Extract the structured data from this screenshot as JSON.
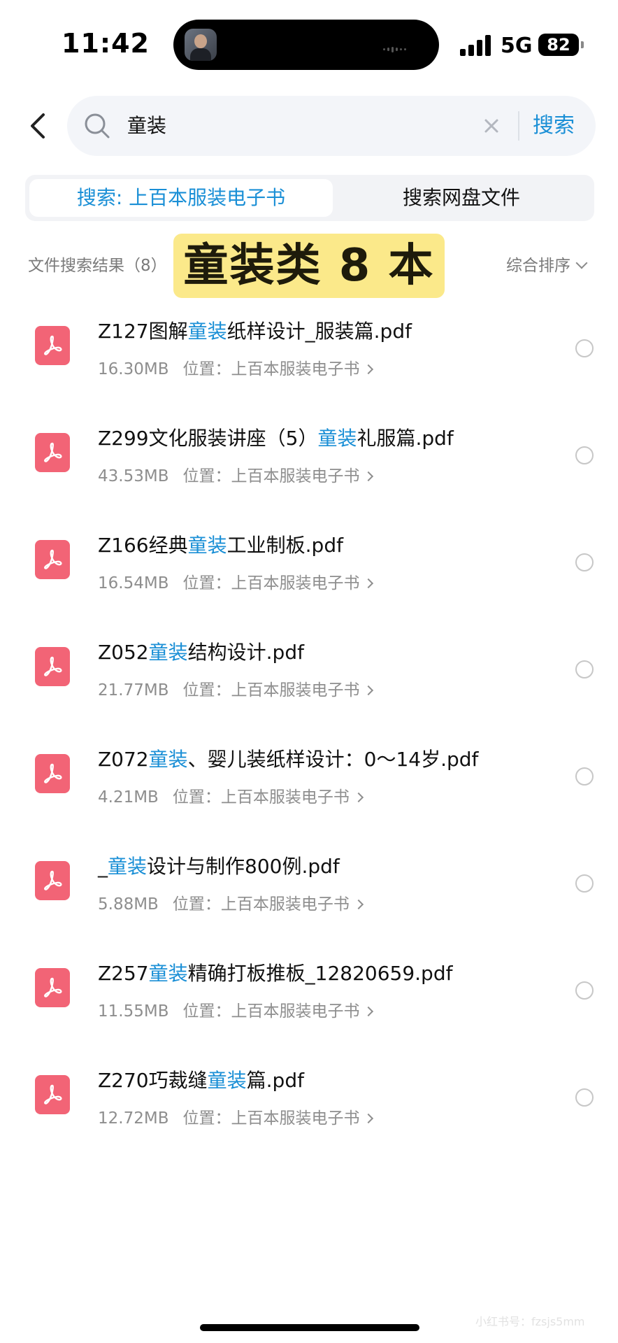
{
  "status_bar": {
    "time": "11:42",
    "network": "5G",
    "battery": "82"
  },
  "search": {
    "query": "童装",
    "button_label": "搜索"
  },
  "tabs": [
    {
      "label": "搜索: 上百本服装电子书",
      "active": true
    },
    {
      "label": "搜索网盘文件",
      "active": false
    }
  ],
  "results": {
    "title": "文件搜索结果（8）",
    "banner": "童装类 8 本",
    "sort_label": "综合排序"
  },
  "location_label": "位置：",
  "highlight_term": "童装",
  "files": [
    {
      "name_before": "Z127图解",
      "name_highlight": "童装",
      "name_after": "纸样设计_服装篇.pdf",
      "size": "16.30MB",
      "location": "上百本服装电子书"
    },
    {
      "name_before": "Z299文化服装讲座（5）",
      "name_highlight": "童装",
      "name_after": "礼服篇.pdf",
      "size": "43.53MB",
      "location": "上百本服装电子书"
    },
    {
      "name_before": "Z166经典",
      "name_highlight": "童装",
      "name_after": "工业制板.pdf",
      "size": "16.54MB",
      "location": "上百本服装电子书"
    },
    {
      "name_before": "Z052",
      "name_highlight": "童装",
      "name_after": "结构设计.pdf",
      "size": "21.77MB",
      "location": "上百本服装电子书"
    },
    {
      "name_before": "Z072",
      "name_highlight": "童装",
      "name_after": "、婴儿装纸样设计：0～14岁.pdf",
      "size": "4.21MB",
      "location": "上百本服装电子书"
    },
    {
      "name_before": "_",
      "name_highlight": "童装",
      "name_after": "设计与制作800例.pdf",
      "size": "5.88MB",
      "location": "上百本服装电子书"
    },
    {
      "name_before": "Z257",
      "name_highlight": "童装",
      "name_after": "精确打板推板_12820659.pdf",
      "size": "11.55MB",
      "location": "上百本服装电子书"
    },
    {
      "name_before": "Z270巧裁缝",
      "name_highlight": "童装",
      "name_after": "篇.pdf",
      "size": "12.72MB",
      "location": "上百本服装电子书"
    }
  ],
  "watermark": "小红书号：fzsjs5mm",
  "colors": {
    "accent": "#1a8fd6",
    "pdf_icon": "#f26476",
    "banner": "#fbe98a"
  }
}
